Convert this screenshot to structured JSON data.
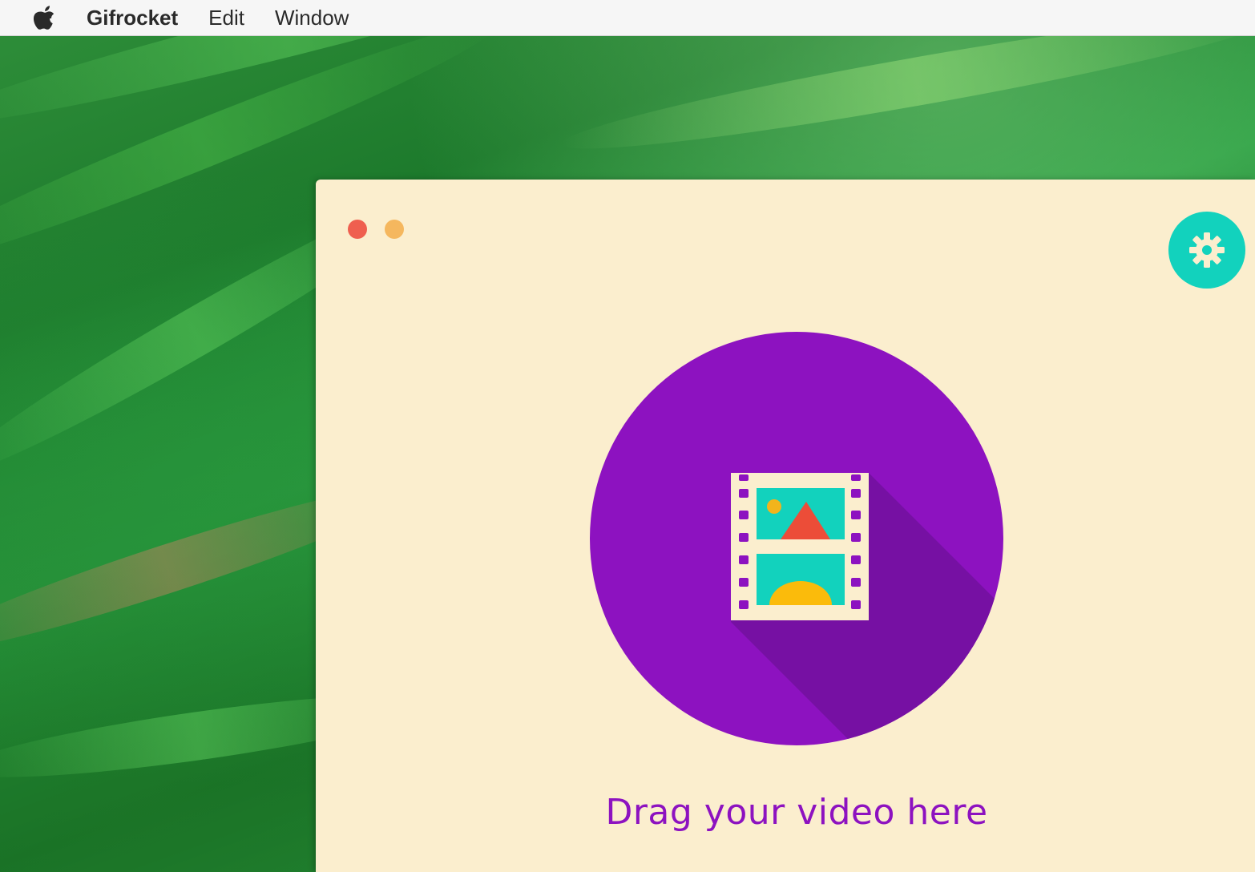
{
  "menubar": {
    "apple_icon": "apple-logo-icon",
    "app_name": "Gifrocket",
    "items": [
      {
        "label": "Edit"
      },
      {
        "label": "Window"
      }
    ]
  },
  "window": {
    "controls": {
      "close_color": "#ef5f4f",
      "minimize_color": "#f5b75e"
    },
    "settings_icon": "gear-icon",
    "drop_zone": {
      "icon": "film-strip-icon",
      "label": "Drag your video here"
    }
  },
  "colors": {
    "background": "#fbeece",
    "accent_purple": "#8d12c0",
    "accent_teal": "#12d2bd"
  }
}
